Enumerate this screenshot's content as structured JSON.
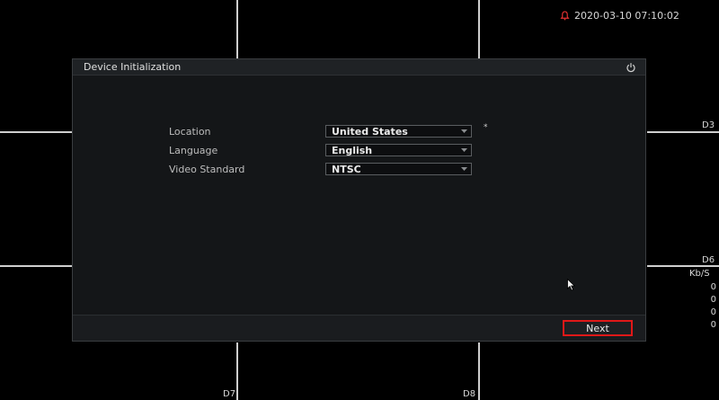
{
  "clock": {
    "datetime": "2020-03-10 07:10:02",
    "icon": "bell-icon"
  },
  "channels": {
    "d3": "D3",
    "d6": "D6",
    "d7": "D7",
    "d8": "D8"
  },
  "stats": {
    "unit": "Kb/S",
    "values": [
      "0",
      "0",
      "0",
      "0"
    ]
  },
  "dialog": {
    "title": "Device Initialization",
    "power_icon": "power-icon",
    "fields": [
      {
        "label": "Location",
        "value": "United States"
      },
      {
        "label": "Language",
        "value": "English"
      },
      {
        "label": "Video Standard",
        "value": "NTSC"
      }
    ],
    "location_mark": "*",
    "next_label": "Next"
  },
  "colors": {
    "accent_border": "#e01818",
    "alarm": "#e03030"
  }
}
